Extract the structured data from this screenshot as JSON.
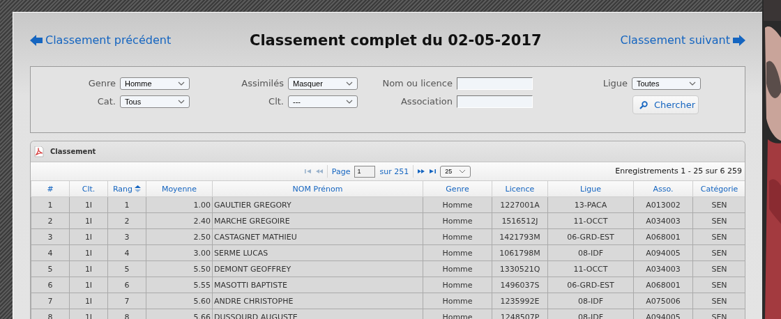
{
  "header": {
    "prev_link": "Classement précédent",
    "title": "Classement complet du 02-05-2017",
    "next_link": "Classement suivant"
  },
  "filters": [
    {
      "kind": "select",
      "label": "Genre",
      "value": "Homme"
    },
    {
      "kind": "select",
      "label": "Assimilés",
      "value": "Masquer"
    },
    {
      "kind": "text",
      "label": "Nom ou licence"
    },
    {
      "kind": "select",
      "label": "Ligue",
      "value": "Toutes"
    },
    {
      "kind": "select",
      "label": "Cat.",
      "value": "Tous"
    },
    {
      "kind": "select",
      "label": "Clt.",
      "value": "---"
    },
    {
      "kind": "text",
      "label": "Association"
    },
    {
      "kind": "button",
      "label": "Chercher"
    }
  ],
  "grid": {
    "caption": "Classement",
    "pager": {
      "nav": [
        {
          "kind": "first",
          "disabled": true
        },
        {
          "kind": "prev",
          "disabled": true
        },
        {
          "kind": "next",
          "disabled": false
        },
        {
          "kind": "last",
          "disabled": false
        }
      ],
      "page_label": "Page",
      "page_value": "1",
      "page_total": "sur 251",
      "page_size": "25",
      "records": "Enregistrements 1 - 25 sur 6 259"
    },
    "columns": [
      {
        "label": "#",
        "sorted": false
      },
      {
        "label": "Clt.",
        "sorted": false
      },
      {
        "label": "Rang",
        "sorted": true
      },
      {
        "label": "Moyenne",
        "sorted": false
      },
      {
        "label": "NOM Prénom",
        "sorted": false
      },
      {
        "label": "Genre",
        "sorted": false
      },
      {
        "label": "Licence",
        "sorted": false
      },
      {
        "label": "Ligue",
        "sorted": false
      },
      {
        "label": "Asso.",
        "sorted": false
      },
      {
        "label": "Catégorie",
        "sorted": false
      }
    ],
    "rows": [
      [
        "1",
        "1I",
        "1",
        "1.00",
        "GAULTIER GREGORY",
        "Homme",
        "1227001A",
        "13-PACA",
        "A013002",
        "SEN"
      ],
      [
        "2",
        "1I",
        "2",
        "2.40",
        "MARCHE GREGOIRE",
        "Homme",
        "1516512J",
        "11-OCCT",
        "A034003",
        "SEN"
      ],
      [
        "3",
        "1I",
        "3",
        "2.50",
        "CASTAGNET MATHIEU",
        "Homme",
        "1421793M",
        "06-GRD-EST",
        "A068001",
        "SEN"
      ],
      [
        "4",
        "1I",
        "4",
        "3.00",
        "SERME LUCAS",
        "Homme",
        "1061798M",
        "08-IDF",
        "A094005",
        "SEN"
      ],
      [
        "5",
        "1I",
        "5",
        "5.50",
        "DEMONT GEOFFREY",
        "Homme",
        "1330521Q",
        "11-OCCT",
        "A034003",
        "SEN"
      ],
      [
        "6",
        "1I",
        "6",
        "5.55",
        "MASOTTI BAPTISTE",
        "Homme",
        "1496037S",
        "06-GRD-EST",
        "A068001",
        "SEN"
      ],
      [
        "7",
        "1I",
        "7",
        "5.60",
        "ANDRE CHRISTOPHE",
        "Homme",
        "1235992E",
        "08-IDF",
        "A075006",
        "SEN"
      ],
      [
        "8",
        "1I",
        "8",
        "5.66",
        "DUSSOURD AUGUSTE",
        "Homme",
        "1248507P",
        "08-IDF",
        "A094005",
        "SEN"
      ]
    ]
  }
}
